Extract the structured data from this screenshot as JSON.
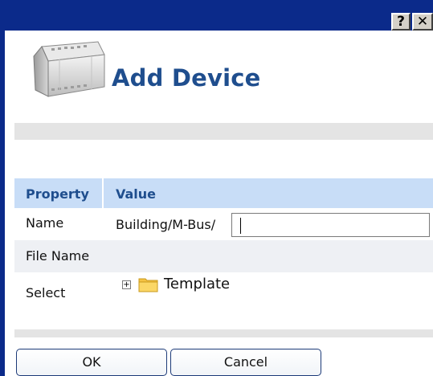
{
  "window": {
    "title_buttons": {
      "help": "?",
      "close": "✕"
    }
  },
  "header": {
    "title": "Add Device",
    "image_icon": "device-module-icon"
  },
  "table": {
    "headers": [
      "Property",
      "Value"
    ],
    "rows": [
      {
        "property": "Name",
        "prefix": "Building/M-Bus/",
        "input_value": ""
      },
      {
        "property": "File Name",
        "value": ""
      },
      {
        "property": "Select",
        "tree": {
          "expand_symbol": "+",
          "icon": "folder-icon",
          "label": "Template"
        }
      }
    ]
  },
  "buttons": {
    "ok": "OK",
    "cancel": "Cancel"
  },
  "colors": {
    "titlebar": "#0b2a8a",
    "header_text": "#1f4e8e",
    "table_header_bg": "#c8ddf7",
    "alt_row_bg": "#eef0f4",
    "separator_bg": "#e4e4e4"
  }
}
